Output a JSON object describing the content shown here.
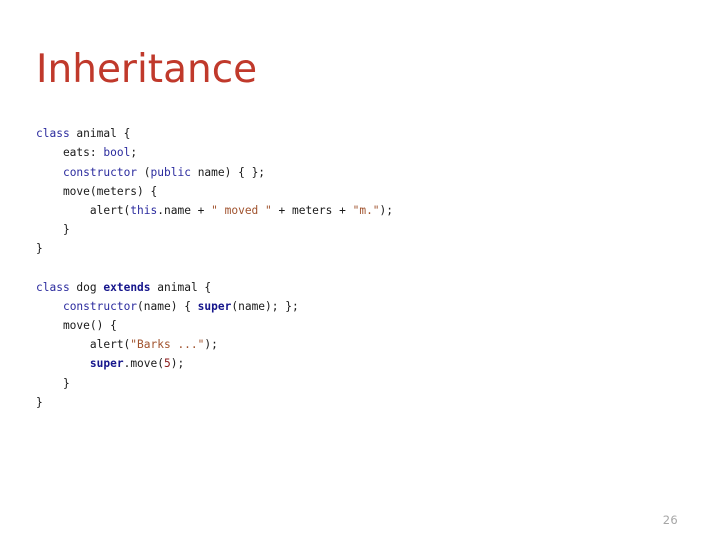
{
  "slide": {
    "title": "Inheritance",
    "page_number": "26",
    "background_color": "#ffffff"
  },
  "theme": {
    "title_color": "#C0392B",
    "keyword_color": "#2b2b9e",
    "keyword_bold_color": "#16168c",
    "string_color": "#a0522d",
    "number_color": "#8b1a1a",
    "plain_color": "#1a1a1a",
    "page_number_color": "#a6a6a6"
  },
  "code": {
    "language": "typescript",
    "plain_text": "class animal {\n    eats: bool;\n    constructor (public name) { };\n    move(meters) {\n        alert(this.name + \" moved \" + meters + \"m.\");\n    }\n}\n\nclass dog extends animal {\n    constructor(name) { super(name); };\n    move() {\n        alert(\"Barks ...\");\n        super.move(5);\n    }\n}",
    "lines": [
      {
        "id": "line-1",
        "tokens": [
          {
            "text": "class",
            "type": "kw"
          },
          {
            "text": " animal {",
            "type": "plain"
          }
        ]
      },
      {
        "id": "line-2",
        "tokens": [
          {
            "text": "    eats: ",
            "type": "plain"
          },
          {
            "text": "bool",
            "type": "kw"
          },
          {
            "text": ";",
            "type": "plain"
          }
        ]
      },
      {
        "id": "line-3",
        "tokens": [
          {
            "text": "    ",
            "type": "plain"
          },
          {
            "text": "constructor",
            "type": "kw"
          },
          {
            "text": " (",
            "type": "plain"
          },
          {
            "text": "public",
            "type": "kw"
          },
          {
            "text": " name) { };",
            "type": "plain"
          }
        ]
      },
      {
        "id": "line-4",
        "tokens": [
          {
            "text": "    move(meters) {",
            "type": "plain"
          }
        ]
      },
      {
        "id": "line-5",
        "tokens": [
          {
            "text": "        alert(",
            "type": "plain"
          },
          {
            "text": "this",
            "type": "kw"
          },
          {
            "text": ".name + ",
            "type": "plain"
          },
          {
            "text": "\" moved \"",
            "type": "str"
          },
          {
            "text": " + meters + ",
            "type": "plain"
          },
          {
            "text": "\"m.\"",
            "type": "str"
          },
          {
            "text": ");",
            "type": "plain"
          }
        ]
      },
      {
        "id": "line-6",
        "tokens": [
          {
            "text": "    }",
            "type": "plain"
          }
        ]
      },
      {
        "id": "line-7",
        "tokens": [
          {
            "text": "}",
            "type": "plain"
          }
        ]
      },
      {
        "id": "line-8",
        "tokens": []
      },
      {
        "id": "line-9",
        "tokens": [
          {
            "text": "class",
            "type": "kw"
          },
          {
            "text": " dog ",
            "type": "plain"
          },
          {
            "text": "extends",
            "type": "kwb"
          },
          {
            "text": " animal {",
            "type": "plain"
          }
        ]
      },
      {
        "id": "line-10",
        "tokens": [
          {
            "text": "    ",
            "type": "plain"
          },
          {
            "text": "constructor",
            "type": "kw"
          },
          {
            "text": "(name) { ",
            "type": "plain"
          },
          {
            "text": "super",
            "type": "kwb"
          },
          {
            "text": "(name); };",
            "type": "plain"
          }
        ]
      },
      {
        "id": "line-11",
        "tokens": [
          {
            "text": "    move() {",
            "type": "plain"
          }
        ]
      },
      {
        "id": "line-12",
        "tokens": [
          {
            "text": "        alert(",
            "type": "plain"
          },
          {
            "text": "\"Barks ...\"",
            "type": "str"
          },
          {
            "text": ");",
            "type": "plain"
          }
        ]
      },
      {
        "id": "line-13",
        "tokens": [
          {
            "text": "        ",
            "type": "plain"
          },
          {
            "text": "super",
            "type": "kwb"
          },
          {
            "text": ".move(",
            "type": "plain"
          },
          {
            "text": "5",
            "type": "num"
          },
          {
            "text": ");",
            "type": "plain"
          }
        ]
      },
      {
        "id": "line-14",
        "tokens": [
          {
            "text": "    }",
            "type": "plain"
          }
        ]
      },
      {
        "id": "line-15",
        "tokens": [
          {
            "text": "}",
            "type": "plain"
          }
        ]
      }
    ]
  }
}
